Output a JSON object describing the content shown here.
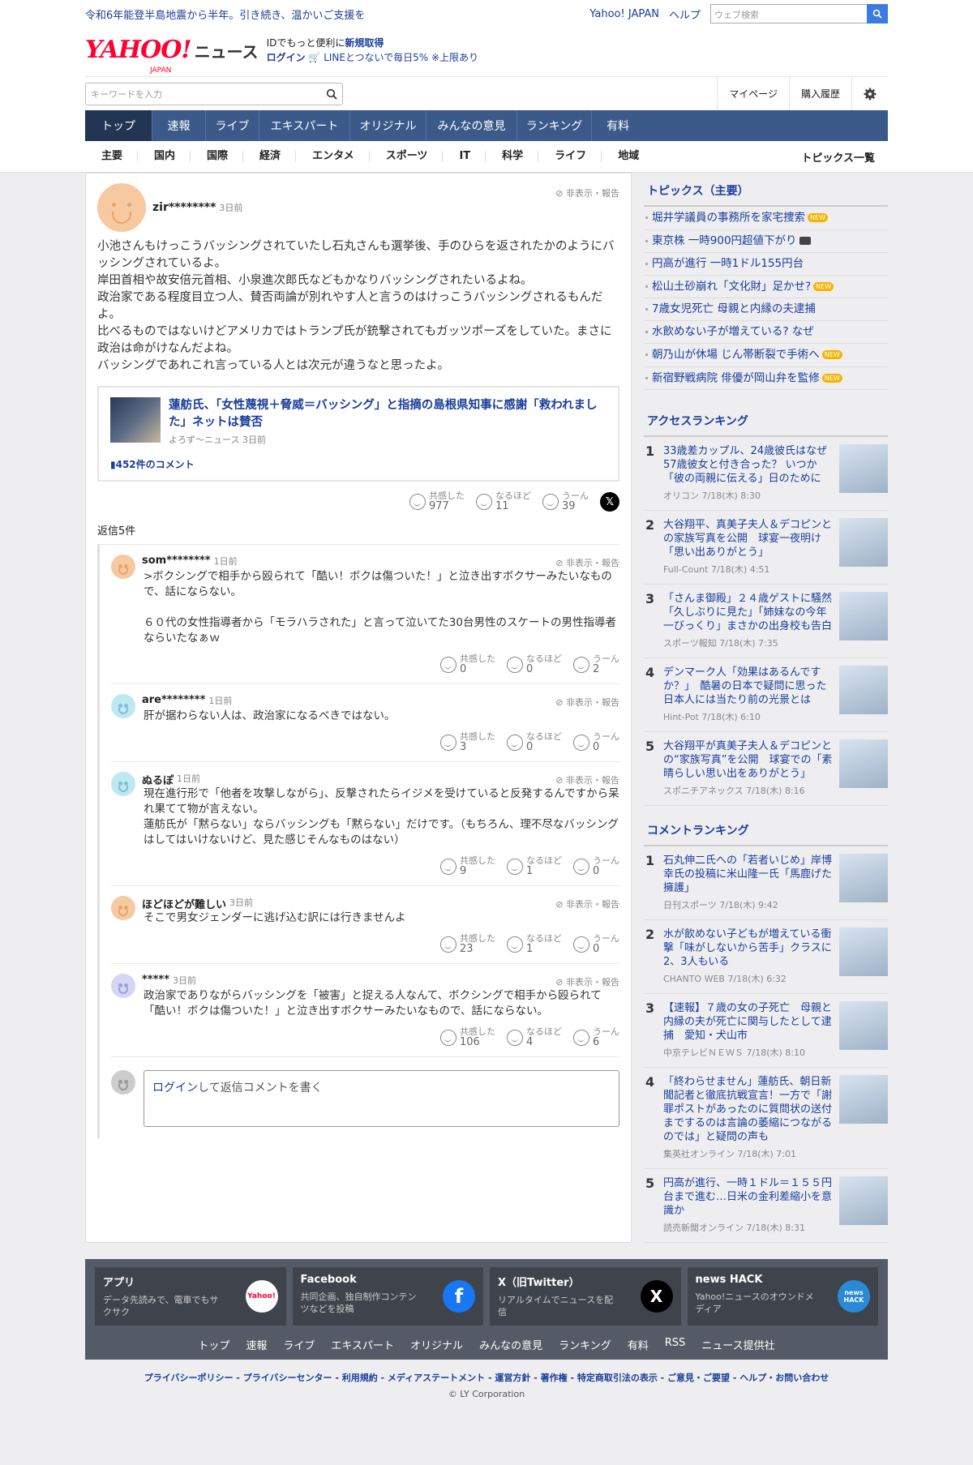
{
  "topbar": {
    "notice": "令和6年能登半島地震から半年。引き続き、温かいご支援を",
    "yahoo_link": "Yahoo! JAPAN",
    "help": "ヘルプ",
    "web_search_placeholder": "ウェブ検索"
  },
  "logo": {
    "brand": "YAHOO!",
    "sub": "JAPAN",
    "news": "ニュース"
  },
  "promo": {
    "line1a": "IDでもっと便利に",
    "line1b": "新規取得",
    "line2a": "ログイン",
    "line2b": "LINEとつないで毎日5% ※上限あり"
  },
  "search": {
    "placeholder": "キーワードを入力",
    "mypage": "マイページ",
    "history": "購入履歴"
  },
  "gnav": [
    "トップ",
    "速報",
    "ライブ",
    "エキスパート",
    "オリジナル",
    "みんなの意見",
    "ランキング",
    "有料"
  ],
  "snav": [
    "主要",
    "国内",
    "国際",
    "経済",
    "エンタメ",
    "スポーツ",
    "IT",
    "科学",
    "ライフ",
    "地域"
  ],
  "snav_all": "トピックス一覧",
  "comment": {
    "user": "zir********",
    "ago": "3日前",
    "hide": "非表示・報告",
    "body": [
      "小池さんもけっこうバッシングされていたし石丸さんも選挙後、手のひらを返されたかのようにバッシングされているよ。",
      "岸田首相や故安倍元首相、小泉進次郎氏などもかなりバッシングされたいるよね。",
      "政治家である程度目立つ人、賛否両論が別れやす人と言うのはけっこうバッシングされるもんだよ。",
      "比べるものではないけどアメリカではトランプ氏が銃撃されてもガッツポーズをしていた。まさに政治は命がけなんだよね。",
      "バッシングであれこれ言っている人とは次元が違うなと思ったよ。"
    ],
    "related_title": "蓮舫氏、「女性蔑視＋脅威＝バッシング」と指摘の島根県知事に感謝「救われました」ネットは賛否",
    "related_src": "よろず～ニュース 3日前",
    "related_count": "452件のコメント",
    "react": {
      "l1": "共感した",
      "v1": "977",
      "l2": "なるほど",
      "v2": "11",
      "l3": "うーん",
      "v3": "39"
    },
    "replies_label": "返信5件"
  },
  "replies": [
    {
      "user": "som********",
      "ago": "1日前",
      "body1": ">ボクシングで相手から殴られて「酷い！ボクは傷ついた！」と泣き出すボクサーみたいなもので、話にならない。",
      "body2": "６０代の女性指導者から「モラハラされた」と言って泣いてた30台男性のスケートの男性指導者ならいたなぁｗ",
      "v1": "0",
      "v2": "0",
      "v3": "2"
    },
    {
      "user": "are********",
      "ago": "1日前",
      "body1": "肝が据わらない人は、政治家になるべきではない。",
      "body2": "",
      "v1": "3",
      "v2": "0",
      "v3": "0"
    },
    {
      "user": "ぬるぽ",
      "ago": "1日前",
      "body1": "現在進行形で「他者を攻撃しながら」、反撃されたらイジメを受けていると反発するんですから呆れ果てて物が言えない。",
      "body2": "蓮舫氏が「黙らない」ならバッシングも「黙らない」だけです。（もちろん、理不尽なバッシングはしてはいけないけど、見た感じそんなものはない）",
      "v1": "9",
      "v2": "1",
      "v3": "0"
    },
    {
      "user": "ほどほどが難しい",
      "ago": "3日前",
      "body1": "そこで男女ジェンダーに逃げ込む訳には行きませんよ",
      "body2": "",
      "v1": "23",
      "v2": "1",
      "v3": "0"
    },
    {
      "user": "*****",
      "ago": "3日前",
      "body1": "政治家でありながらバッシングを「被害」と捉える人なんて、ボクシングで相手から殴られて「酷い！ボクは傷ついた！」と泣き出すボクサーみたいなもので、話にならない。",
      "body2": "",
      "v1": "106",
      "v2": "4",
      "v3": "6"
    }
  ],
  "reply_box": {
    "login": "ログイン",
    "text": "して返信コメントを書く"
  },
  "topics": {
    "title": "トピックス（主要）",
    "items": [
      "堀井学議員の事務所を家宅捜索",
      "東京株 一時900円超値下がり",
      "円高が進行 一時1ドル155円台",
      "松山土砂崩れ「文化財」足かせ?",
      "7歳女児死亡 母親と内縁の夫逮捕",
      "水飲めない子が増えている? なぜ",
      "朝乃山が休場 じん帯断裂で手術へ",
      "新宿野戦病院 俳優が岡山弁を監修"
    ],
    "new_badge": "NEW"
  },
  "access": {
    "title": "アクセスランキング",
    "items": [
      {
        "n": "1",
        "t": "33歳差カップル、24歳彼氏はなぜ57歳彼女と付き合った？ いつか「彼の両親に伝える」日のために",
        "s": "オリコン 7/18(木) 8:30"
      },
      {
        "n": "2",
        "t": "大谷翔平、真美子夫人＆デコピンとの家族写真を公開　球宴一夜明け「思い出ありがとう」",
        "s": "Full-Count 7/18(木) 4:51"
      },
      {
        "n": "3",
        "t": "「さんま御殿」２４歳ゲストに騒然「久しぶりに見た」「姉妹なの今年一びっくり」まさかの出身校も告白",
        "s": "スポーツ報知 7/18(木) 7:35"
      },
      {
        "n": "4",
        "t": "デンマーク人「効果はあるんですか？」　酷暑の日本で疑問に思った　日本人には当たり前の光景とは",
        "s": "Hint-Pot 7/18(木) 6:10"
      },
      {
        "n": "5",
        "t": "大谷翔平が真美子夫人＆デコピンとの“家族写真”を公開　球宴での「素晴らしい思い出をありがとう」",
        "s": "スポニチアネックス 7/18(木) 8:16"
      }
    ]
  },
  "commentrank": {
    "title": "コメントランキング",
    "items": [
      {
        "n": "1",
        "t": "石丸伸二氏への「若者いじめ」岸博幸氏の投稿に米山隆一氏「馬鹿げた擁護」",
        "s": "日刊スポーツ 7/18(木) 9:42"
      },
      {
        "n": "2",
        "t": "水が飲めない子どもが増えている衝撃「味がしないから苦手」クラスに2、3人もいる",
        "s": "CHANTO WEB 7/18(木) 6:32"
      },
      {
        "n": "3",
        "t": "【速報】７歳の女の子死亡　母親と内縁の夫が死亡に関与したとして逮捕　愛知・犬山市",
        "s": "中京テレビＮＥＷＳ 7/18(木) 8:10"
      },
      {
        "n": "4",
        "t": "「終わらせません」蓮舫氏、朝日新聞記者と徹底抗戦宣言！一方で「謝罪ポストがあったのに質問状の送付までするのは言論の萎縮につながるのでは」と疑問の声も",
        "s": "集英社オンライン 7/18(木) 7:01"
      },
      {
        "n": "5",
        "t": "円高が進行、一時１ドル＝１５５円台まで進む…日米の金利差縮小を意識か",
        "s": "読売新聞オンライン 7/18(木) 8:31"
      }
    ]
  },
  "footer": {
    "cards": [
      {
        "t": "アプリ",
        "d": "データ先読みで、電車でもサクサク",
        "i": "Yahoo!"
      },
      {
        "t": "Facebook",
        "d": "共同企画、独自制作コンテンツなどを投稿",
        "i": "f"
      },
      {
        "t": "X（旧Twitter）",
        "d": "リアルタイムでニュースを配信",
        "i": "X"
      },
      {
        "t": "news HACK",
        "d": "Yahoo!ニュースのオウンドメディア",
        "i": "news HACK"
      }
    ],
    "links": [
      "トップ",
      "速報",
      "ライブ",
      "エキスパート",
      "オリジナル",
      "みんなの意見",
      "ランキング",
      "有料",
      "RSS",
      "ニュース提供社"
    ],
    "bottom": "プライバシーポリシー - プライバシーセンター - 利用規約 - メディアステートメント - 運営方針 - 著作権 - 特定商取引法の表示 - ご意見・ご要望 - ヘルプ・お問い合わせ",
    "copy": "© LY Corporation"
  }
}
